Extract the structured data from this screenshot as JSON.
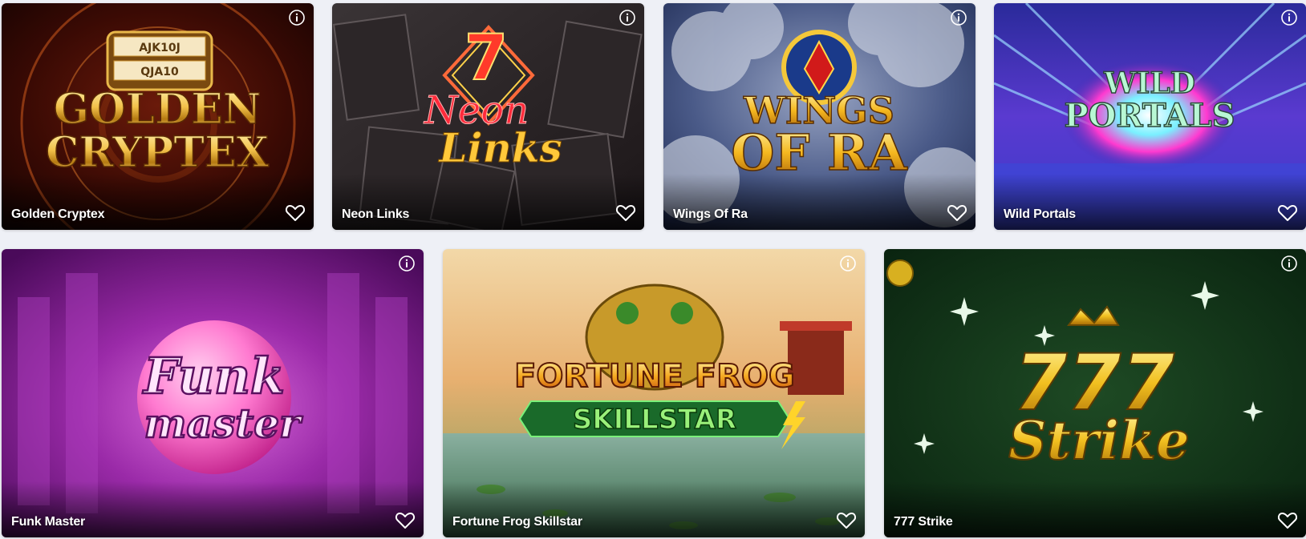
{
  "games_row_1": [
    {
      "title": "Golden Cryptex",
      "logo_line_1": "GOLDEN",
      "logo_line_2": "CRYPTEX",
      "cryptex_letters": "AJK10J",
      "cryptex_letters_2": "QJA10"
    },
    {
      "title": "Neon Links",
      "logo_line_1": "Neon",
      "logo_line_2": "Links",
      "logo_number": "7"
    },
    {
      "title": "Wings Of Ra",
      "logo_line_1": "WINGS",
      "logo_line_2": "OF RA"
    },
    {
      "title": "Wild Portals",
      "logo_line_1": "WILD",
      "logo_line_2": "PORTALS"
    }
  ],
  "games_row_2": [
    {
      "title": "Funk Master",
      "logo_line_1": "Funk",
      "logo_line_2": "master"
    },
    {
      "title": "Fortune Frog Skillstar",
      "logo_line_1": "FORTUNE FROG",
      "logo_line_2": "SKILLSTAR"
    },
    {
      "title": "777 Strike",
      "logo_line_1": "777",
      "logo_line_2": "Strike"
    }
  ],
  "icons": {
    "info": "info-icon",
    "favorite": "heart-outline-icon"
  },
  "colors": {
    "page_background": "#eef0f6",
    "title_text": "#ffffff"
  }
}
